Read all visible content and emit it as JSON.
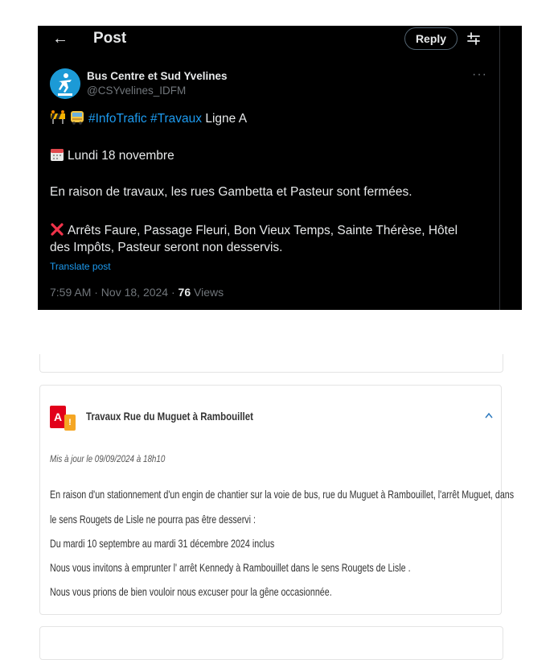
{
  "post": {
    "header": {
      "back_glyph": "←",
      "title": "Post",
      "reply_label": "Reply"
    },
    "author": {
      "name": "Bus Centre et Sud Yvelines",
      "handle": "@CSYvelines_IDFM",
      "more_glyph": "···"
    },
    "lines": {
      "hashtag1": "#InfoTrafic",
      "hashtag2": "#Travaux",
      "line_label": " Ligne A",
      "date": "Lundi 18 novembre",
      "reason": "En raison de travaux, les rues Gambetta et Pasteur sont fermées.",
      "stops_1": "Arrêts Faure, Passage Fleuri, Bon Vieux Temps, Sainte Thérèse, Hôtel",
      "stops_2": "des Impôts, Pasteur seront non desservis."
    },
    "translate_label": "Translate post",
    "meta": {
      "time": "7:59 AM · Nov 18, 2024 · ",
      "views_count": "76",
      "views_label": " Views"
    },
    "icons": {
      "emoji_1": "construction-icon",
      "emoji_2": "bus-icon",
      "emoji_3": "calendar-icon",
      "emoji_4": "cross-mark-icon"
    }
  },
  "card": {
    "badge_line": "A",
    "badge_warn": "!",
    "title": "Travaux Rue du Muguet à Rambouillet",
    "updated": "Mis à jour le 09/09/2024 à 18h10",
    "para_1": "En raison d'un stationnement d'un engin de chantier sur la voie de bus, rue du Muguet à Rambouillet, l'arrêt Muguet, dans",
    "para_2": "le sens Rougets de Lisle ne pourra pas être desservi :",
    "para_3": "Du mardi 10 septembre au mardi 31 décembre 2024 inclus",
    "para_4": "Nous vous invitons à emprunter l' arrêt Kennedy à Rambouillet dans le sens Rougets de Lisle .",
    "para_5": "Nous vous prions de bien vouloir nous excuser pour la gêne occasionnée."
  },
  "colors": {
    "link_blue": "#1d9bf0",
    "line_a_red": "#e2001a",
    "warning_orange": "#f5a623",
    "chevron_blue": "#2f7bbf"
  }
}
